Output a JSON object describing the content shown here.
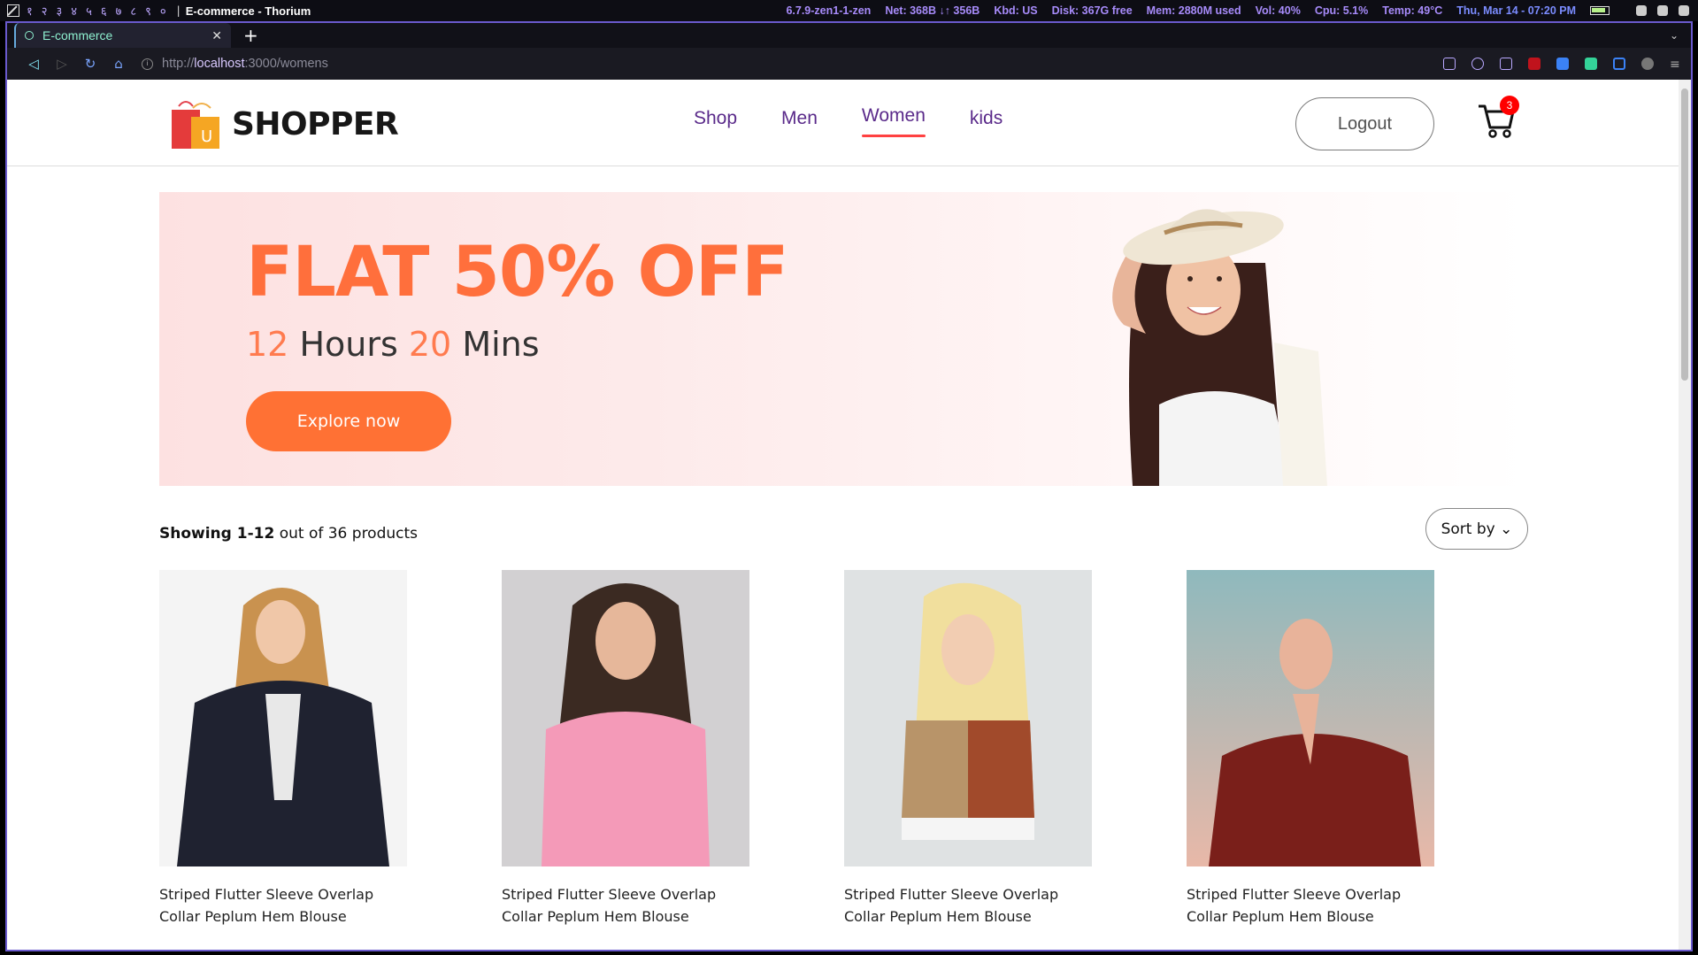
{
  "system_bar": {
    "workspaces": [
      "१",
      "२",
      "३",
      "४",
      "५",
      "६",
      "७",
      "८",
      "९",
      "०"
    ],
    "window_title": "E-commerce - Thorium",
    "kernel": "6.7.9-zen1-1-zen",
    "net": "Net: 368B ↓↑ 356B",
    "kbd": "Kbd: US",
    "disk": "Disk: 367G free",
    "mem": "Mem: 2880M used",
    "vol": "Vol: 40%",
    "cpu": "Cpu: 5.1%",
    "temp": "Temp: 49°C",
    "datetime": "Thu, Mar 14 - 07:20 PM"
  },
  "browser": {
    "tab_title": "E-commerce",
    "url_scheme": "http://",
    "url_host": "localhost",
    "url_path": ":3000/womens"
  },
  "navbar": {
    "brand": "SHOPPER",
    "links": [
      "Shop",
      "Men",
      "Women",
      "kids"
    ],
    "active_link": "Women",
    "logout": "Logout",
    "cart_count": "3"
  },
  "hero": {
    "title": "FLAT 50% OFF",
    "hours": "12",
    "hours_label": "Hours",
    "mins": "20",
    "mins_label": "Mins",
    "cta": "Explore now"
  },
  "listing": {
    "showing_range": "Showing 1-12",
    "showing_rest": "out of 36 products",
    "sort": "Sort by"
  },
  "products": [
    {
      "name": "Striped Flutter Sleeve Overlap Collar Peplum Hem Blouse"
    },
    {
      "name": "Striped Flutter Sleeve Overlap Collar Peplum Hem Blouse"
    },
    {
      "name": "Striped Flutter Sleeve Overlap Collar Peplum Hem Blouse"
    },
    {
      "name": "Striped Flutter Sleeve Overlap Collar Peplum Hem Blouse"
    }
  ],
  "colors": {
    "accent": "#ff7134",
    "nav_text": "#5a2a8a",
    "active_underline": "#ff4141",
    "badge": "#ff0000"
  }
}
